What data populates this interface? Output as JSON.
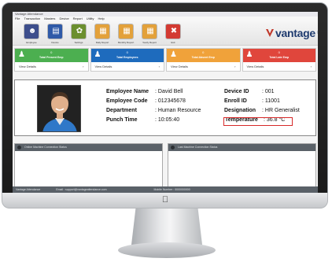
{
  "window": {
    "title": "Vantage Attendance"
  },
  "menu": [
    "File",
    "Transaction",
    "Masters",
    "Device",
    "Report",
    "Utility",
    "Help"
  ],
  "toolbar": {
    "buttons": [
      {
        "label": "Employee",
        "icon": "person-icon",
        "color": "#3d4e8c"
      },
      {
        "label": "Device",
        "icon": "device-icon",
        "color": "#2f5aa8"
      },
      {
        "label": "Settings",
        "icon": "color-wheel-icon",
        "color": "#6b8f2e"
      },
      {
        "label": "Daily Report",
        "icon": "calendar-icon",
        "color": "#e3a13a"
      },
      {
        "label": "Monthly Report",
        "icon": "calendar-icon",
        "color": "#e3a13a"
      },
      {
        "label": "Yearly Report",
        "icon": "calendar-icon",
        "color": "#e3a13a"
      },
      {
        "label": "Exit",
        "icon": "close-icon",
        "color": "#d33a32"
      }
    ],
    "brand": "vantage",
    "brand_suffix": "®"
  },
  "tiles": [
    {
      "name": "Total Present Emp",
      "value": "0",
      "color": "#4caf50",
      "link": "View Details"
    },
    {
      "name": "Total Employees",
      "value": "0",
      "color": "#1e6bbd",
      "link": "View Details"
    },
    {
      "name": "Total Absent Emp",
      "value": "0",
      "color": "#f0a23a",
      "link": "View Details"
    },
    {
      "name": "Total Late Emp",
      "value": "0",
      "color": "#e0463c",
      "link": "View Details"
    }
  ],
  "employee": {
    "name_label": "Employee Name",
    "name": ": David Bell",
    "code_label": "Employee Code",
    "code": ": 012345678",
    "dept_label": "Department",
    "dept": ": Human Resource",
    "punch_label": "Punch Time",
    "punch": ": 10:05:40",
    "device_label": "Device ID",
    "device": ": 001",
    "enroll_label": "Enroll ID",
    "enroll": ": 11001",
    "desig_label": "Designation",
    "desig": ": HR Generalist",
    "temp_label": "Temperature",
    "temp": ": 36.8 °C"
  },
  "panes": {
    "left": "Online Machine Connection Status",
    "right": "Last Machine Connection Status"
  },
  "footer": {
    "company": "Vantage Attendance",
    "email": "Email : support@vantageattendance.com",
    "phone": "Mobile Number : 0000000000"
  }
}
